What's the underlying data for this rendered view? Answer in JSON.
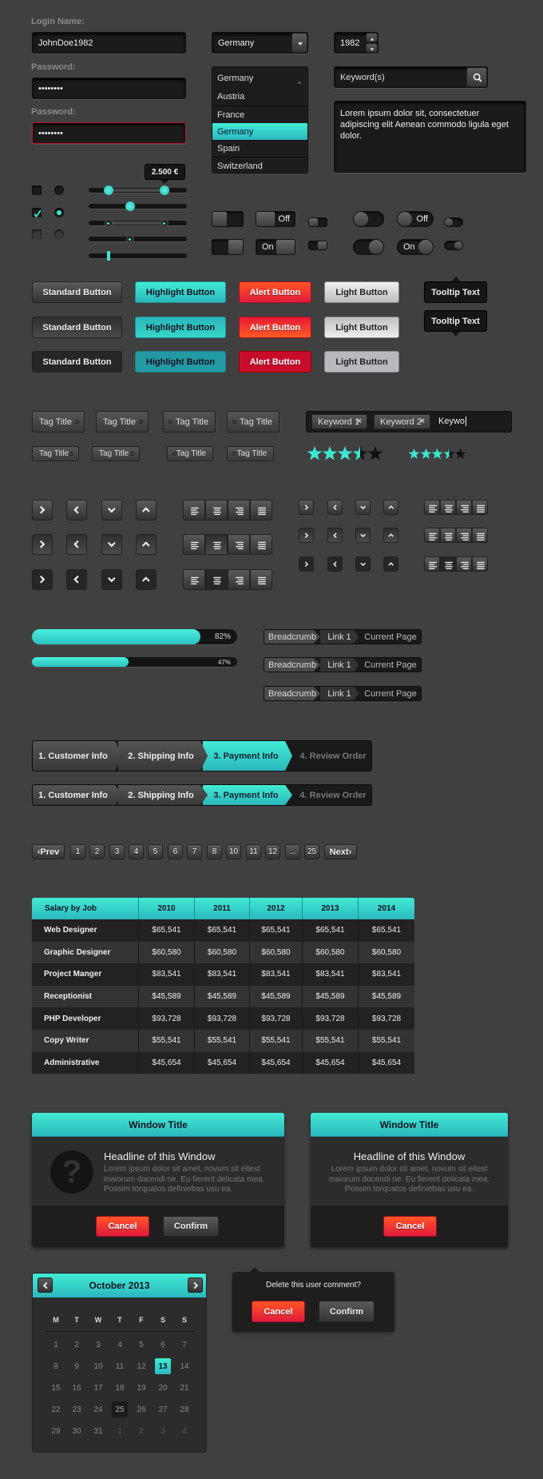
{
  "form": {
    "login_label": "Login Name:",
    "login_value": "JohnDoe1982",
    "password_label": "Password:",
    "password_value": "••••••••",
    "password2_label": "Password:",
    "password2_value": "••••••••",
    "country_select": "Germany",
    "year_value": "1982",
    "dropdown": {
      "header": "Germany",
      "items": [
        "Austria",
        "France",
        "Germany",
        "Spain",
        "Switzerland"
      ],
      "selected_index": 2
    },
    "search_placeholder": "Keyword(s)",
    "textarea_value": "Lorem ipsum dolor sit, consectetuer adipiscing elit Aenean commodo ligula eget dolor.",
    "slider_tooltip": "2.500 €",
    "sliders": [
      [
        0.2,
        0.77
      ],
      [
        0.42
      ],
      [
        0.2,
        0.77
      ],
      [
        0.42
      ],
      [
        0.2
      ]
    ],
    "checkboxes": [
      false,
      true,
      false
    ],
    "toggle_off": "Off",
    "toggle_on": "On"
  },
  "buttons": {
    "standard": "Standard Button",
    "highlight": "Highlight Button",
    "alert": "Alert Button",
    "light": "Light Button",
    "tooltip": "Tooltip Text"
  },
  "tags": {
    "label": "Tag Title",
    "keywords": [
      "Keyword 1",
      "Keyword 2"
    ],
    "typed": "Keywo",
    "ratings": [
      3.5,
      3.5
    ]
  },
  "progress": [
    {
      "value": 82,
      "label": "82%"
    },
    {
      "value": 47,
      "label": "47%"
    }
  ],
  "breadcrumb": [
    "Breadcrumb",
    "Link 1",
    "Current Page"
  ],
  "wizard": {
    "steps": [
      "1. Customer Info",
      "2. Shipping Info",
      "3. Payment Info",
      "4. Review Order"
    ],
    "active": 2
  },
  "pagination": {
    "prev": "Prev",
    "pages": [
      "1",
      "2",
      "3",
      "4",
      "5",
      "6",
      "7",
      "8",
      "10",
      "11",
      "12",
      "...",
      "25"
    ],
    "next": "Next"
  },
  "table": {
    "headers": [
      "Salary by Job",
      "2010",
      "2011",
      "2012",
      "2013",
      "2014"
    ],
    "rows": [
      [
        "Web Designer",
        "$65,541",
        "$65,541",
        "$65,541",
        "$65,541",
        "$65,541"
      ],
      [
        "Graphic Designer",
        "$60,580",
        "$60,580",
        "$60,580",
        "$60,580",
        "$60,580"
      ],
      [
        "Project Manger",
        "$83,541",
        "$83,541",
        "$83,541",
        "$83,541",
        "$83,541"
      ],
      [
        "Receptionist",
        "$45,589",
        "$45,589",
        "$45,589",
        "$45,589",
        "$45,589"
      ],
      [
        "PHP Developer",
        "$93,728",
        "$93,728",
        "$93,728",
        "$93,728",
        "$93,728"
      ],
      [
        "Copy Writer",
        "$55,541",
        "$55,541",
        "$55,541",
        "$55,541",
        "$55,541"
      ],
      [
        "Administrative",
        "$45,654",
        "$45,654",
        "$45,654",
        "$45,654",
        "$45,654"
      ]
    ]
  },
  "window": {
    "title": "Window Title",
    "headline": "Headline of this Window",
    "body": "Lorem ipsum dolor sit amet, novum sit eitest maiorum docendi ne. Eu fierent delicata mea. Possim torquatos definiebas usu ea.",
    "cancel": "Cancel",
    "confirm": "Confirm"
  },
  "calendar": {
    "month": "October 2013",
    "weekdays": [
      "M",
      "T",
      "W",
      "T",
      "F",
      "S",
      "S"
    ],
    "days": [
      "1",
      "2",
      "3",
      "4",
      "5",
      "6",
      "7",
      "8",
      "9",
      "10",
      "11",
      "12",
      "13",
      "14",
      "15",
      "16",
      "17",
      "18",
      "19",
      "20",
      "21",
      "22",
      "23",
      "24",
      "25",
      "26",
      "27",
      "28",
      "29",
      "30",
      "31",
      "1",
      "2",
      "3",
      "4"
    ],
    "selected": "13",
    "highlighted": "25"
  },
  "popup": {
    "question": "Delete this user comment?",
    "cancel": "Cancel",
    "confirm": "Confirm"
  },
  "colors": {
    "accent": "#3ee6d2",
    "alert": "#f0283a",
    "background": "#404040"
  }
}
